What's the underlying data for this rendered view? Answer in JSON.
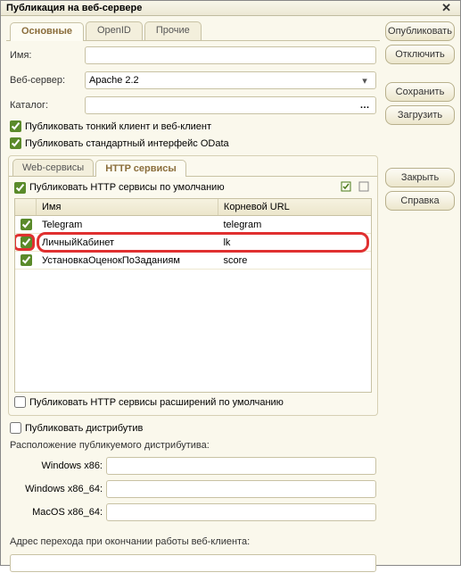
{
  "title": "Публикация на веб-сервере",
  "tabs_top": {
    "main": "Основные",
    "openid": "OpenID",
    "other": "Прочие"
  },
  "buttons": {
    "publish": "Опубликовать",
    "disconnect": "Отключить",
    "save": "Сохранить",
    "load": "Загрузить",
    "close": "Закрыть",
    "help": "Справка"
  },
  "labels": {
    "name": "Имя:",
    "webserver": "Веб-сервер:",
    "catalog": "Каталог:",
    "publish_thin": "Публиковать тонкий клиент и веб-клиент",
    "publish_odata": "Публиковать стандартный интерфейс OData",
    "publish_http_default": "Публиковать HTTP сервисы по умолчанию",
    "publish_http_ext": "Публиковать HTTP сервисы расширений по умолчанию",
    "publish_dist": "Публиковать дистрибутив",
    "dist_location": "Расположение публикуемого дистрибутива:",
    "win86": "Windows x86:",
    "win64": "Windows x86_64:",
    "mac64": "MacOS x86_64:",
    "exit_addr": "Адрес перехода при окончании работы веб-клиента:"
  },
  "webserver_value": "Apache 2.2",
  "inner_tabs": {
    "web": "Web-сервисы",
    "http": "HTTP сервисы"
  },
  "table": {
    "headers": {
      "name": "Имя",
      "url": "Корневой URL"
    },
    "rows": [
      {
        "checked": true,
        "name": "Telegram",
        "url": "telegram",
        "hl": false
      },
      {
        "checked": true,
        "name": "ЛичныйКабинет",
        "url": "lk",
        "hl": true
      },
      {
        "checked": true,
        "name": "УстановкаОценокПоЗаданиям",
        "url": "score",
        "hl": false
      }
    ]
  },
  "checks": {
    "publish_thin": true,
    "publish_odata": true,
    "publish_http_default": true,
    "publish_http_ext": false,
    "publish_dist": false
  }
}
